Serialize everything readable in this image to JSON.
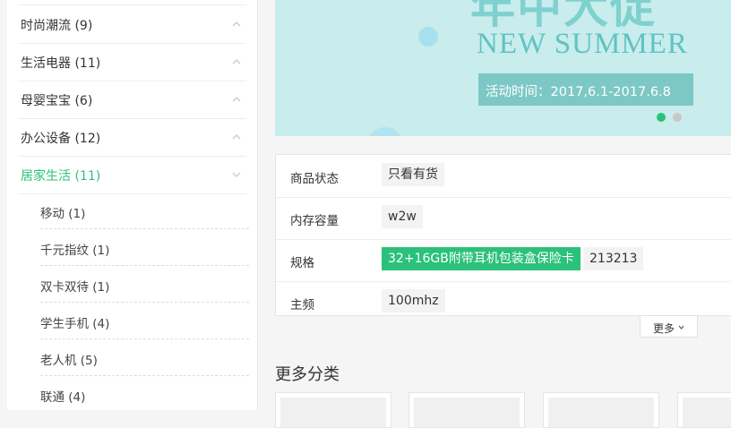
{
  "sidebar": {
    "categories": [
      {
        "label": "时尚潮流 (9)"
      },
      {
        "label": "生活电器 (11)"
      },
      {
        "label": "母婴宝宝 (6)"
      },
      {
        "label": "办公设备 (12)"
      },
      {
        "label": "居家生活 (11)"
      }
    ],
    "subcategories": [
      {
        "label": "移动 (1)"
      },
      {
        "label": "千元指纹 (1)"
      },
      {
        "label": "双卡双待 (1)"
      },
      {
        "label": "学生手机 (4)"
      },
      {
        "label": "老人机 (5)"
      },
      {
        "label": "联通 (4)"
      }
    ]
  },
  "banner": {
    "headline": "年中大促",
    "subtitle": "NEW SUMMER",
    "date_text": "活动时间：2017,6.1-2017.6.8"
  },
  "specs": {
    "rows": [
      {
        "name": "商品状态",
        "options": [
          "只看有货"
        ]
      },
      {
        "name": "内存容量",
        "options": [
          "w2w"
        ]
      },
      {
        "name": "规格",
        "options": [
          "32+16GB附带耳机包装盒保险卡",
          "213213"
        ]
      },
      {
        "name": "主频",
        "options": [
          "100mhz"
        ]
      }
    ],
    "more_label": "更多"
  },
  "more_categories": {
    "title": "更多分类"
  },
  "colors": {
    "accent": "#2bc17b",
    "banner_bg": "#c9ecec"
  }
}
